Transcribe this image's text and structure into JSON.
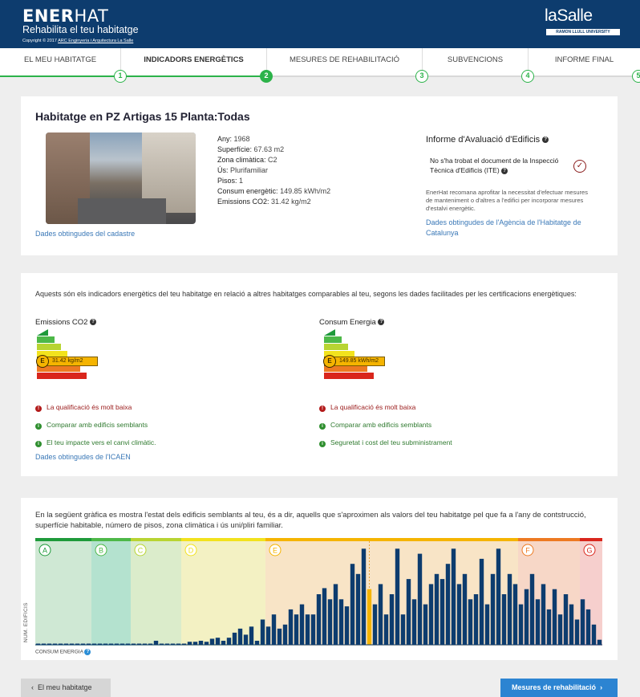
{
  "header": {
    "brand_bold": "ENER",
    "brand_light": "HAT",
    "subtitle": "Rehabilita el teu habitatge",
    "copyright_prefix": "Copyright © 2017",
    "copyright_link": "ARC Enginyeria i Arquitectura La Salle",
    "partner_logo": "laSalle",
    "partner_sub": "RAMON LLULL UNIVERSITY"
  },
  "tabs": [
    {
      "label": "El meu habitatge",
      "step": "1",
      "active": false
    },
    {
      "label": "Indicadors energètics",
      "step": "2",
      "active": true
    },
    {
      "label": "Mesures de rehabilitació",
      "step": "3",
      "active": false
    },
    {
      "label": "Subvencions",
      "step": "4",
      "active": false
    },
    {
      "label": "Informe final",
      "step": "5",
      "active": false
    }
  ],
  "dwelling": {
    "title": "Habitatge en PZ Artigas 15 Planta:Todas",
    "cadastre_link": "Dades obtingudes del cadastre",
    "fields": [
      {
        "label": "Any:",
        "value": "1968"
      },
      {
        "label": "Superfície:",
        "value": "67.63 m2"
      },
      {
        "label": "Zona climàtica:",
        "value": "C2"
      },
      {
        "label": "Ús:",
        "value": "Plurifamiliar"
      },
      {
        "label": "Pisos:",
        "value": "1"
      },
      {
        "label": "Consum energètic:",
        "value": "149.85 kWh/m2"
      },
      {
        "label": "Emissions CO2:",
        "value": "31.42 kg/m2"
      }
    ],
    "ite": {
      "title": "Informe d'Avaluació d'Edificis",
      "status": "No s'ha trobat el document de la Inspecció Tècnica d'Edificis (ITE)",
      "description": "EnerHat recomana aprofitar la necessitat d'efectuar mesures de manteniment o d'altres a l'edifici per incorporar mesures d'estalvi energètic.",
      "link": "Dades obtingudes de l'Agència de l'Habitatge de Catalunya"
    }
  },
  "indicators": {
    "intro": "Aquests són els indicadors energètics del teu habitatge en relació a altres habitatges comparables al teu, segons les dades facilitades per les certificacions energètiques:",
    "source_link": "Dades obtingudes de l'ICAEN",
    "band_colors": [
      "#1e9a3a",
      "#4db848",
      "#b8d432",
      "#f2e21d",
      "#f5b400",
      "#ed7a22",
      "#d9261c"
    ],
    "co2": {
      "title": "Emissions CO2",
      "grade": "E",
      "value_text": "31.42 kg/m2",
      "bullets": [
        {
          "kind": "bad",
          "text": "La qualificació és molt baixa"
        },
        {
          "kind": "good",
          "text": "Comparar amb edificis semblants"
        },
        {
          "kind": "good",
          "text": "El teu impacte vers el canvi climàtic."
        }
      ]
    },
    "energy": {
      "title": "Consum Energia",
      "grade": "E",
      "value_text": "149.85 kWh/m2",
      "bullets": [
        {
          "kind": "bad",
          "text": "La qualificació és molt baixa"
        },
        {
          "kind": "good",
          "text": "Comparar amb edificis semblants"
        },
        {
          "kind": "good",
          "text": "Seguretat i cost del teu subministrament"
        }
      ]
    }
  },
  "comparison": {
    "intro": "En la següent gràfica es mostra l'estat dels edificis semblants al teu, és a dir, aquells que s'aproximen als valors del teu habitatge pel que fa a l'any de contstrucció, superfície habitable, número de pisos, zona climàtica i ús uni/pliri familiar.",
    "ylabel": "NUM. EDIFICIS",
    "xlabel": "CONSUM ENERGIA"
  },
  "chart_data": {
    "type": "bar",
    "title": "",
    "xlabel": "CONSUM ENERGIA",
    "ylabel": "NUM. EDIFICIS",
    "grades": [
      {
        "letter": "A",
        "zone_color": "#cfe8d4",
        "top_color": "#1e9a3a"
      },
      {
        "letter": "B",
        "zone_color": "#b4e2cf",
        "top_color": "#4db848"
      },
      {
        "letter": "C",
        "zone_color": "#dbeccb",
        "top_color": "#b8d432"
      },
      {
        "letter": "D",
        "zone_color": "#f3f1c3",
        "top_color": "#f2e21d"
      },
      {
        "letter": "E",
        "zone_color": "#f8e4c6",
        "top_color": "#f5b400"
      },
      {
        "letter": "F",
        "zone_color": "#f7d7c7",
        "top_color": "#ed7a22"
      },
      {
        "letter": "G",
        "zone_color": "#f6cfcd",
        "top_color": "#d9261c"
      }
    ],
    "grade_boundaries": [
      0,
      10,
      17,
      26,
      41,
      86,
      97,
      101
    ],
    "highlight_index": 59,
    "values": [
      1,
      1,
      1,
      1,
      1,
      1,
      1,
      1,
      1,
      1,
      1,
      1,
      1,
      1,
      1,
      1,
      1,
      1,
      1,
      1,
      1,
      4,
      1,
      1,
      1,
      1,
      1,
      3,
      3,
      4,
      3,
      6,
      7,
      4,
      7,
      12,
      16,
      10,
      18,
      4,
      25,
      18,
      30,
      16,
      20,
      35,
      30,
      40,
      30,
      30,
      50,
      56,
      45,
      60,
      45,
      38,
      80,
      70,
      95,
      55,
      40,
      60,
      30,
      50,
      95,
      30,
      65,
      45,
      90,
      40,
      60,
      70,
      65,
      80,
      95,
      60,
      70,
      45,
      50,
      85,
      40,
      70,
      95,
      50,
      70,
      60,
      40,
      55,
      70,
      45,
      60,
      35,
      55,
      30,
      50,
      40,
      25,
      45,
      35,
      20,
      5
    ],
    "ylim": [
      0,
      100
    ]
  },
  "footer": {
    "back_label": "El meu habitatge",
    "next_label": "Mesures de rehabilitació"
  }
}
